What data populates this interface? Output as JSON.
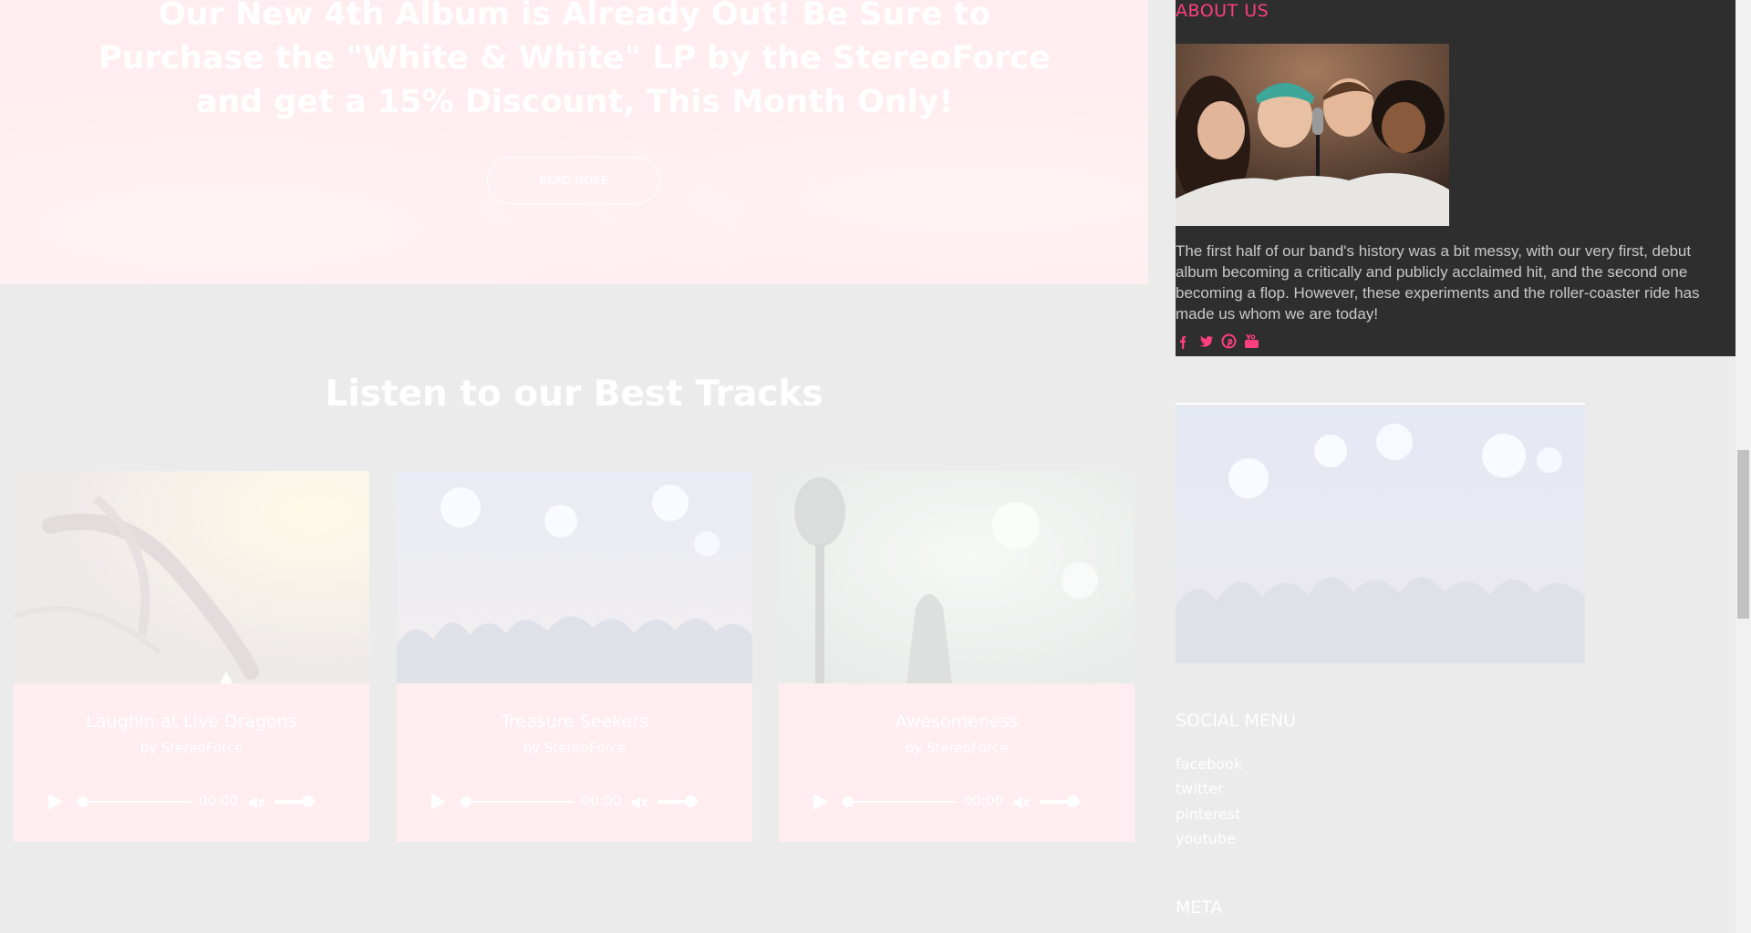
{
  "hero": {
    "title": "Our New 4th Album is Already Out! Be Sure to Purchase the \"White & White\" LP by the StereoForce and get a 15% Discount, This Month Only!",
    "button_label": "READ MORE"
  },
  "tracks": {
    "heading": "Listen to our Best Tracks",
    "items": [
      {
        "title": "Laughin at Live Dragons",
        "artist": "by StereoForce",
        "time": "00:00"
      },
      {
        "title": "Treasure Seekers",
        "artist": "by StereoForce",
        "time": "00:00"
      },
      {
        "title": "Awesomeness",
        "artist": "by StereoForce",
        "time": "00:00"
      }
    ]
  },
  "sidebar": {
    "about": {
      "heading": "ABOUT US",
      "text": "The first half of our band's history was a bit messy, with our very first, debut album becoming a critically and publicly acclaimed hit, and the second one becoming a flop. However, these experiments and the roller-coaster ride has made us whom we are today!",
      "icons": [
        "facebook-icon",
        "twitter-icon",
        "pinterest-icon",
        "youtube-icon"
      ]
    },
    "social_menu": {
      "heading": "SOCIAL MENU",
      "links": [
        "facebook",
        "twitter",
        "pinterest",
        "youtube"
      ]
    },
    "meta": {
      "heading": "META"
    }
  },
  "colors": {
    "accent": "#ff3f7f",
    "page_bg": "#ebebeb",
    "card_bg": "#ffedf0",
    "about_bg": "#2e2e2e"
  }
}
